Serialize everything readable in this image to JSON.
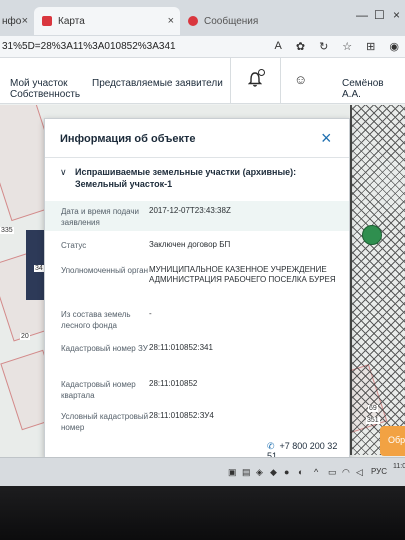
{
  "browser": {
    "tabs": [
      {
        "label": "нфо",
        "active": false
      },
      {
        "label": "Карта",
        "active": true
      },
      {
        "label": "Сообщения",
        "active": false
      }
    ],
    "tab_close": "×",
    "url": "31%5D=28%3A11%3A010852%3A341",
    "window_close": "×"
  },
  "header": {
    "nav_my_area_line1": "Мой участок",
    "nav_my_area_line2": "Собственность",
    "nav_represented": "Представляемые заявители",
    "user_name": "Семёнов А.А."
  },
  "map": {
    "labels": [
      "335",
      "34",
      "20",
      "69",
      "351"
    ]
  },
  "modal": {
    "title": "Информация об объекте",
    "close": "×",
    "section_title": "Испрашиваемые земельные участки (архивные): Земельный участок-1",
    "rows": [
      {
        "label": "Дата и время подачи заявления",
        "value": "2017-12-07T23:43:38Z"
      },
      {
        "label": "Статус",
        "value": "Заключен договор БП"
      },
      {
        "label": "Уполномоченный орган",
        "value": "МУНИЦИПАЛЬНОЕ КАЗЕННОЕ УЧРЕЖДЕНИЕ АДМИНИСТРАЦИЯ РАБОЧЕГО ПОСЕЛКА БУРЕЯ"
      },
      {
        "label": "Из состава земель лесного фонда",
        "value": "-"
      },
      {
        "label": "Кадастровый номер ЗУ",
        "value": "28:11:010852:341"
      },
      {
        "label": "Кадастровый номер квартала",
        "value": "28:11:010852"
      },
      {
        "label": "Условный кадастровый номер",
        "value": "28:11:010852:ЗУ4"
      }
    ],
    "phone": "+7 800 200 32 51"
  },
  "order_button": "Обр",
  "taskbar": {
    "lang": "РУС",
    "time": "11:0"
  },
  "colors": {
    "accent_blue": "#1e6fb0",
    "header_text": "#1c2b3a",
    "highlight_row": "#eef5f4",
    "order_orange": "#f2a243"
  }
}
